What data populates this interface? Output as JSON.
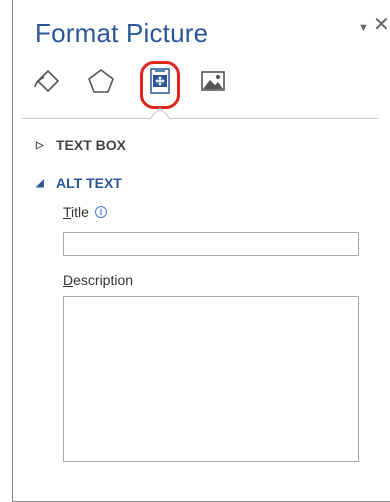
{
  "pane": {
    "title": "Format Picture",
    "tabs": [
      {
        "name": "fill-line",
        "icon": "paint-bucket-icon"
      },
      {
        "name": "effects",
        "icon": "pentagon-icon"
      },
      {
        "name": "layout-properties",
        "icon": "size-properties-icon",
        "selected": true
      },
      {
        "name": "picture",
        "icon": "picture-icon"
      }
    ],
    "highlight_color": "#e0261b",
    "accent_color": "#2b579a"
  },
  "sections": {
    "text_box": {
      "label": "TEXT BOX",
      "expanded": false
    },
    "alt_text": {
      "label": "ALT TEXT",
      "expanded": true
    }
  },
  "fields": {
    "title_label_first": "T",
    "title_label_rest": "itle",
    "title_info": "i",
    "title_value": "",
    "description_label_first": "D",
    "description_label_rest": "escription",
    "description_value": ""
  },
  "controls": {
    "dropdown_glyph": "▼",
    "close_glyph": "✕",
    "collapsed_caret": "▷",
    "expanded_caret": "◢"
  }
}
